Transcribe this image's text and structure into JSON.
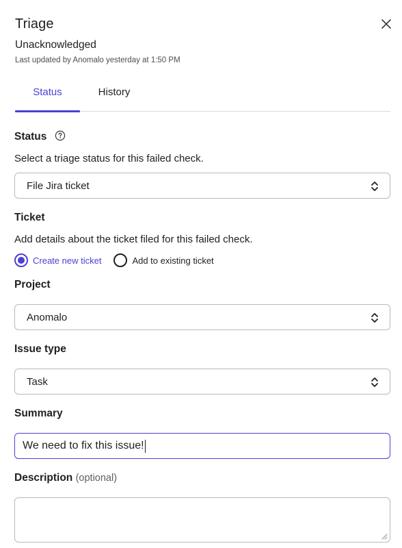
{
  "panel": {
    "title": "Triage",
    "state": "Unacknowledged",
    "last_updated": "Last updated by Anomalo yesterday at 1:50 PM"
  },
  "tabs": [
    {
      "label": "Status",
      "active": true
    },
    {
      "label": "History",
      "active": false
    }
  ],
  "status_section": {
    "heading": "Status",
    "hint": "Select a triage status for this failed check.",
    "selected": "File Jira ticket"
  },
  "ticket_section": {
    "heading": "Ticket",
    "hint": "Add details about the ticket filed for this failed check.",
    "options": [
      {
        "label": "Create new ticket",
        "checked": true
      },
      {
        "label": "Add to existing ticket",
        "checked": false
      }
    ]
  },
  "project_section": {
    "heading": "Project",
    "selected": "Anomalo"
  },
  "issue_type_section": {
    "heading": "Issue type",
    "selected": "Task"
  },
  "summary_section": {
    "heading": "Summary",
    "value": "We need to fix this issue!"
  },
  "description_section": {
    "heading": "Description",
    "optional_label": "(optional)",
    "value": ""
  },
  "icons": {
    "close": "close-icon",
    "help": "question-circle-icon",
    "select": "chevron-up-down-icon",
    "resize": "resize-grip-icon"
  },
  "colors": {
    "accent": "#4b3fd6",
    "text": "#1f1f23",
    "border": "#b9b9c0"
  }
}
